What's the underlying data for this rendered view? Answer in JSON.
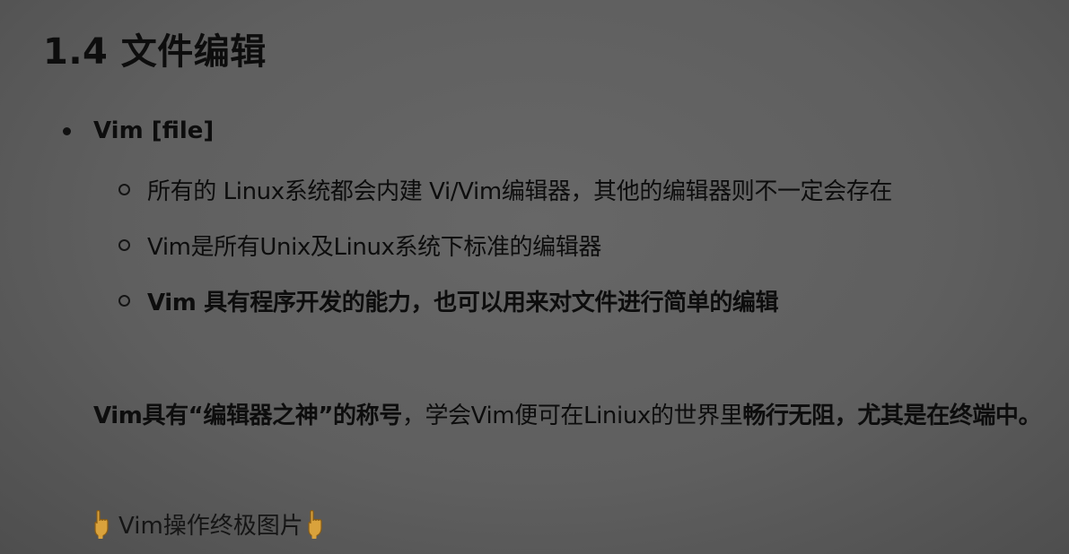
{
  "section": {
    "heading": "1.4 文件编辑"
  },
  "bullet": {
    "text": "Vim [file]"
  },
  "sub_items": [
    {
      "text": "所有的 Linux系统都会内建 Vi/Vim编辑器，其他的编辑器则不一定会存在",
      "bold": false
    },
    {
      "text": "Vim是所有Unix及Linux系统下标准的编辑器",
      "bold": false
    },
    {
      "text": "Vim 具有程序开发的能力，也可以用来对文件进行简单的编辑",
      "bold": true
    }
  ],
  "paragraph": {
    "part1_bold": "Vim具有“编辑器之神”的称号",
    "part2": "，学会Vim便可在Liniux的世界里",
    "part3_bold": "畅行无阻，尤其是在终端中。"
  },
  "pointer_line": {
    "text": "Vim操作终极图片",
    "icon": "pointing-down-hand-icon",
    "icon_color": "#d9a23c"
  },
  "colors": {
    "text": "#0d0d0d",
    "background": "#5f5f5f"
  }
}
